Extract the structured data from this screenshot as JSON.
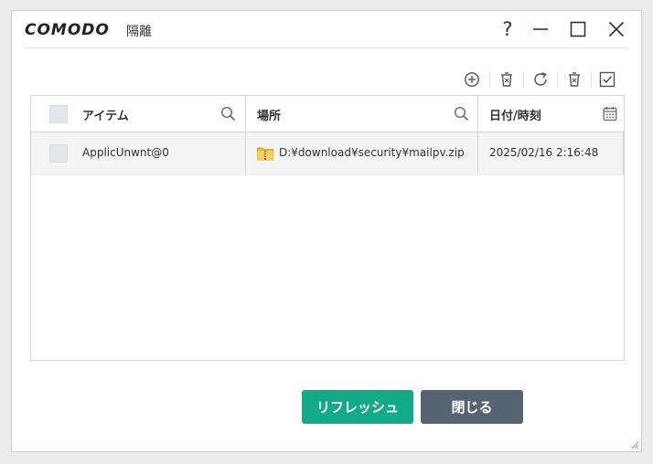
{
  "window": {
    "logo_text": "COMODO",
    "title": "隔離",
    "controls": {
      "help_label": "?",
      "help_icon": "question-mark",
      "minimize_icon": "minimize",
      "maximize_icon": "maximize",
      "close_icon": "close"
    }
  },
  "toolbar": {
    "icons": [
      "add-circle-icon",
      "delete-icon",
      "restore-icon",
      "delete-all-icon",
      "select-all-icon"
    ]
  },
  "table": {
    "columns": [
      {
        "label": "アイテム",
        "icon": "search-icon"
      },
      {
        "label": "場所",
        "icon": "search-icon"
      },
      {
        "label": "日付/時刻",
        "icon": "calendar-icon"
      }
    ],
    "rows": [
      {
        "item": "ApplicUnwnt@0",
        "location": "D:¥download¥security¥mailpv.zip",
        "location_icon": "zip-folder-icon",
        "datetime": "2025/02/16 2:16:48"
      }
    ]
  },
  "buttons": {
    "refresh": "リフレッシュ",
    "close": "閉じる"
  },
  "colors": {
    "refresh": "#13aa87",
    "close": "#566370"
  }
}
